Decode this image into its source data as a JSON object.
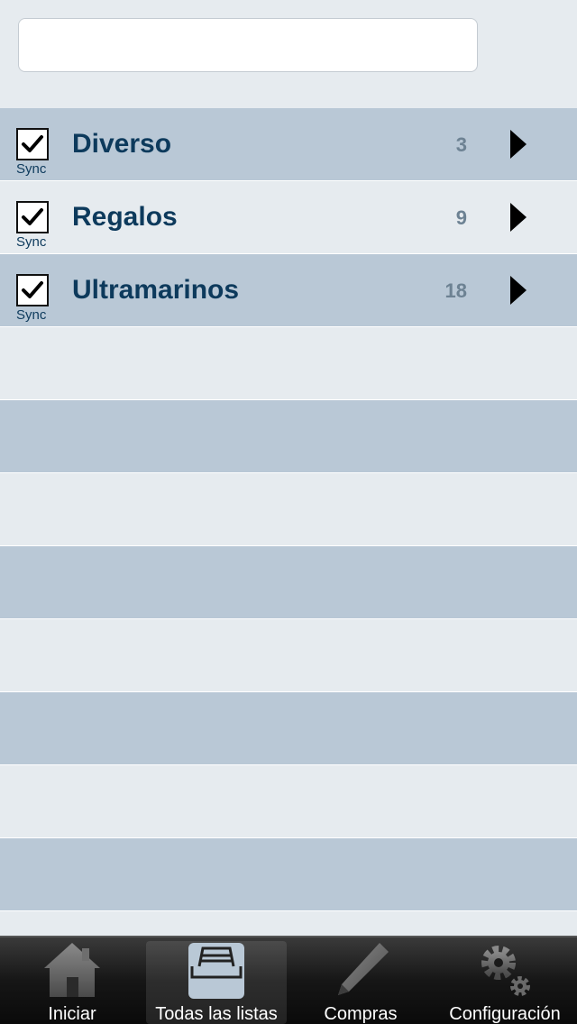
{
  "search": {
    "value": "",
    "placeholder": ""
  },
  "lists": [
    {
      "title": "Diverso",
      "count": "3",
      "sync_label": "Sync",
      "synced": true
    },
    {
      "title": "Regalos",
      "count": "9",
      "sync_label": "Sync",
      "synced": true
    },
    {
      "title": "Ultramarinos",
      "count": "18",
      "sync_label": "Sync",
      "synced": true
    }
  ],
  "empty_rows": 8,
  "colors": {
    "row_dark": "#b9c8d6",
    "row_light": "#e6ebef",
    "title_text": "#0d3a5c",
    "count_text": "#6d8293",
    "tabbar": "#161616"
  },
  "tabbar": {
    "selected": "all-lists",
    "tabs": [
      {
        "id": "home",
        "label": "Iniciar",
        "icon": "house-icon"
      },
      {
        "id": "all-lists",
        "label": "Todas las listas",
        "icon": "card-box-icon"
      },
      {
        "id": "shopping",
        "label": "Compras",
        "icon": "pencil-icon"
      },
      {
        "id": "settings",
        "label": "Configuración",
        "icon": "gear-icon"
      }
    ]
  }
}
